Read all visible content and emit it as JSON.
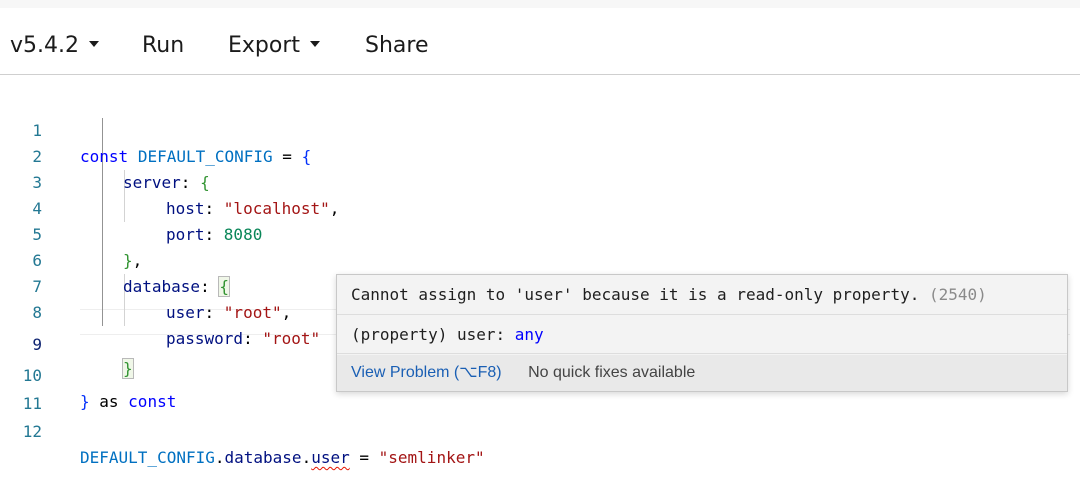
{
  "toolbar": {
    "version_label": "v5.4.2",
    "run_label": "Run",
    "export_label": "Export",
    "share_label": "Share"
  },
  "editor": {
    "line_numbers": [
      "1",
      "2",
      "3",
      "4",
      "5",
      "6",
      "7",
      "8",
      "9",
      "10",
      "11",
      "12"
    ],
    "active_line": "9",
    "lines": {
      "l1": {
        "kw": "const",
        "id": "DEFAULT_CONFIG",
        "op": " = ",
        "brace": "{"
      },
      "l2": {
        "prop": "server",
        "colon": ": ",
        "brace": "{"
      },
      "l3": {
        "prop": "host",
        "colon": ": ",
        "str": "\"localhost\"",
        "comma": ","
      },
      "l4": {
        "prop": "port",
        "colon": ": ",
        "num": "8080"
      },
      "l5": {
        "brace": "}",
        "comma": ","
      },
      "l6": {
        "prop": "database",
        "colon": ": ",
        "brace": "{"
      },
      "l7": {
        "prop": "user",
        "colon": ": ",
        "str": "\"root\"",
        "comma": ","
      },
      "l8": {
        "prop": "password",
        "colon": ": ",
        "str": "\"root\""
      },
      "l9": {
        "brace": "}"
      },
      "l10": {
        "brace": "}",
        "as": " as ",
        "kw": "const"
      },
      "l12": {
        "id": "DEFAULT_CONFIG",
        "dot1": ".",
        "prop1": "database",
        "dot2": ".",
        "prop2": "user",
        "op": " = ",
        "str": "\"semlinker\""
      }
    }
  },
  "hover": {
    "message": "Cannot assign to 'user' because it is a read-only property.",
    "error_code": "(2540)",
    "signature_prefix": "(property) user: ",
    "signature_type": "any",
    "view_problem": "View Problem (⌥F8)",
    "no_fixes": "No quick fixes available"
  }
}
